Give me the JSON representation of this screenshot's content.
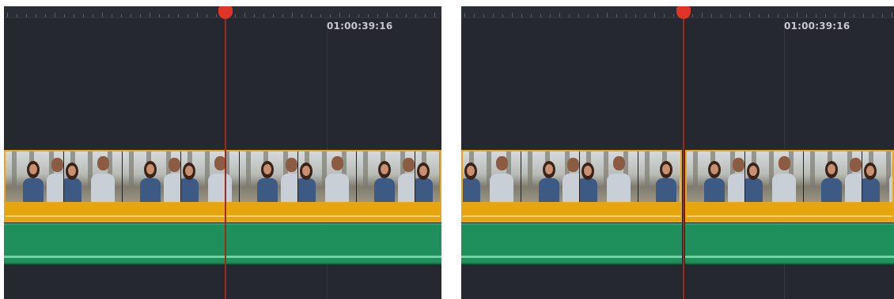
{
  "panels": [
    {
      "id": "left",
      "timecode": "01:00:39:16",
      "playhead_color": "#e03426",
      "video_track": {
        "clip_count": 1
      },
      "audio_track_color": "#e6a40e",
      "second_audio_track_color": "#1f8f5c"
    },
    {
      "id": "right",
      "timecode": "01:00:39:16",
      "playhead_color": "#e03426",
      "video_track": {
        "clip_count": 2
      },
      "audio_track_color": "#e6a40e",
      "second_audio_track_color": "#1f8f5c"
    }
  ],
  "icons": [
    "playhead-icon"
  ]
}
